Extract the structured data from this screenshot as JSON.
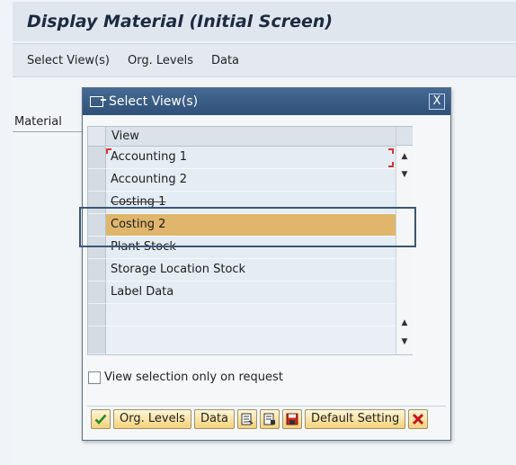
{
  "window": {
    "title": "Display Material (Initial Screen)"
  },
  "menu": [
    "Select View(s)",
    "Org. Levels",
    "Data"
  ],
  "main": {
    "material_label": "Material"
  },
  "dialog": {
    "title": "Select View(s)",
    "close_label": "X",
    "table": {
      "column": "View",
      "rows": [
        {
          "label": "Accounting 1",
          "selected": false
        },
        {
          "label": "Accounting 2",
          "selected": false
        },
        {
          "label": "Costing 1",
          "selected": false
        },
        {
          "label": "Costing 2",
          "selected": true
        },
        {
          "label": "Plant Stock",
          "selected": false
        },
        {
          "label": "Storage Location Stock",
          "selected": false
        },
        {
          "label": "Label Data",
          "selected": false
        },
        {
          "label": "",
          "selected": false
        },
        {
          "label": "",
          "selected": false
        }
      ]
    },
    "view_selection_checkbox": {
      "label": "View selection only on request",
      "checked": false
    },
    "buttons": {
      "org_levels": "Org. Levels",
      "data": "Data",
      "default_setting": "Default Setting"
    }
  },
  "colors": {
    "dialog_header": "#2f5078",
    "selected_row": "#e0b66c",
    "button_bg": "#f4d27a",
    "confirm": "#2b8a2b",
    "cancel": "#c8141e"
  }
}
